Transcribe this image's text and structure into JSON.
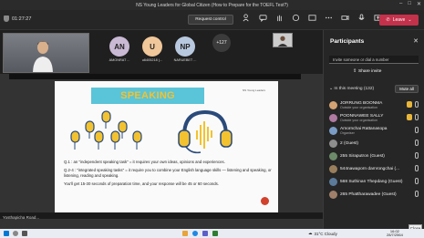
{
  "window": {
    "title": "NS Young Leaders for Global Citizen (How to Prepare for the TOEFL Test?)"
  },
  "toolbar": {
    "timer": "01:27:27",
    "request_control": "Request control",
    "leave_label": "Leave",
    "icons": [
      "people-icon",
      "chat-icon",
      "hand-icon",
      "reactions-icon",
      "view-icon",
      "more-icon",
      "camera-icon",
      "mic-icon",
      "share-icon"
    ]
  },
  "video_strip": {
    "avatars": [
      {
        "initials": "AN",
        "name": "AMONRAT ...",
        "color": "#c9b9d4"
      },
      {
        "initials": "U",
        "name": "u6405218 (...",
        "color": "#f0c79a"
      },
      {
        "initials": "NP",
        "name": "NARUEBET ...",
        "color": "#b8c8de"
      }
    ],
    "more_count": "+127"
  },
  "slide": {
    "banner": "SPEAKING",
    "logo_text": "NS Young Leaders",
    "paragraphs": [
      "Q.1 : an \"independent speaking task\" = it requires your own ideas, opinions and experiences.",
      "Q.2-4 : \"integrated speaking tasks\" = it require you to combine your English language skills — listening and speaking, or listening, reading and speaking.",
      "You'll get 15-30 seconds of preparation time, and your response will be 45 or 60 seconds."
    ]
  },
  "presenter": {
    "label": "Yosthapicha Road..."
  },
  "panel": {
    "title": "Participants",
    "invite_placeholder": "Invite someone or dial a number",
    "share_invite": "Share invite",
    "meeting_header": "In this meeting (132)",
    "mute_all": "Mute all",
    "close_tooltip": "Close",
    "participants": [
      {
        "name": "JORRUNG BOONMA",
        "sub": "Outside your organisation",
        "color": "#d4a373",
        "hand": true
      },
      {
        "name": "POONNAWEE SALLY",
        "sub": "Outside your organisation",
        "color": "#b07aa1",
        "hand": true
      },
      {
        "name": "Amornchai Rattanasopa",
        "sub": "Organiser",
        "color": "#7a9cc6",
        "hand": false
      },
      {
        "name": "2 (Guest)",
        "sub": "",
        "color": "#8e8e8e",
        "hand": false
      },
      {
        "name": "255 Siraputron (Guest)",
        "sub": "",
        "color": "#6d8a6a",
        "hand": false
      },
      {
        "name": "544nawaporn damrongchai (...",
        "sub": "",
        "color": "#9a7f5c",
        "hand": false
      },
      {
        "name": "568 Suthinan Thepdang (Guest)",
        "sub": "",
        "color": "#5c7a9a",
        "hand": false
      },
      {
        "name": "265 Phattharawadee (Guest)",
        "sub": "",
        "color": "#a0806a",
        "hand": false
      }
    ]
  },
  "taskbar": {
    "weather": "31°C Cloudy",
    "time": "16:02",
    "date": "28/7/2564"
  }
}
